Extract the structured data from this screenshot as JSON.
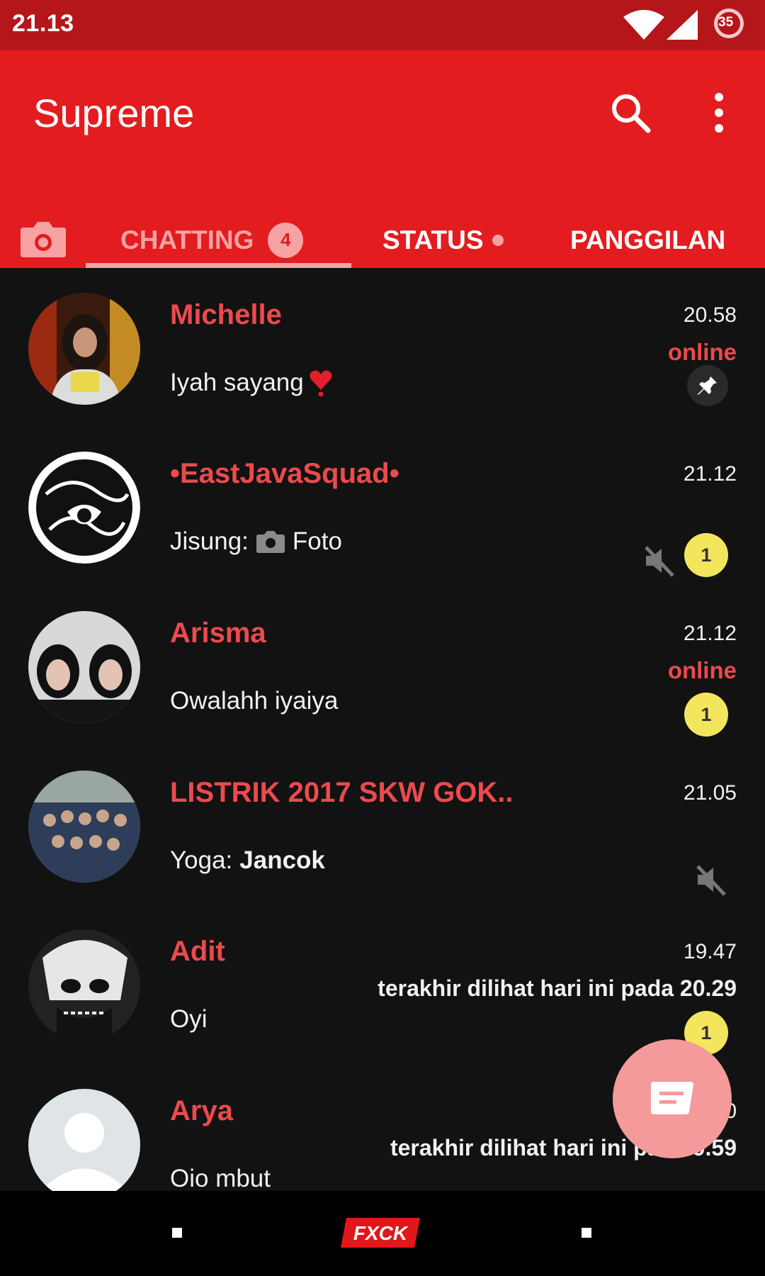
{
  "status_bar": {
    "time": "21.13",
    "battery_level": "35"
  },
  "app_bar": {
    "title": "Supreme",
    "search_icon": "search-icon",
    "menu_icon": "more-vert-icon"
  },
  "tabs": {
    "camera_icon": "camera-icon",
    "chat_label": "CHATTING",
    "chat_unread": "4",
    "status_label": "STATUS",
    "calls_label": "PANGGILAN"
  },
  "chats": [
    {
      "name": "Michelle",
      "time": "20.58",
      "presence": "online",
      "message": "Iyah sayang",
      "pinned": true
    },
    {
      "name": "•EastJavaSquad•",
      "time": "21.12",
      "sender": "Jisung:",
      "message": "Foto",
      "muted": true,
      "unread": "1"
    },
    {
      "name": "Arisma",
      "time": "21.12",
      "presence": "online",
      "message": "Owalahh iyaiya",
      "unread": "1"
    },
    {
      "name": "LISTRIK 2017 SKW GOK..",
      "time": "21.05",
      "sender": "Yoga:",
      "message": "Jancok",
      "muted": true
    },
    {
      "name": "Adit",
      "time": "19.47",
      "last_seen": "terakhir dilihat hari ini pada 20.29",
      "message": "Oyi",
      "unread": "1"
    },
    {
      "name": "Arya",
      "time": "0",
      "last_seen": "terakhir dilihat hari ini pada",
      "last_seen_time": "9.59",
      "message": "Oio mbut"
    }
  ],
  "fab": {
    "icon": "new-chat-icon"
  },
  "nav_bar": {
    "logo_text": "FXCK"
  },
  "colors": {
    "status_bar": "#b5161a",
    "app_bar": "#e31c1f",
    "accent_pink": "#f7a3a4",
    "name_red": "#ec4a4d",
    "badge_yellow": "#f3e65c",
    "background": "#121212"
  }
}
